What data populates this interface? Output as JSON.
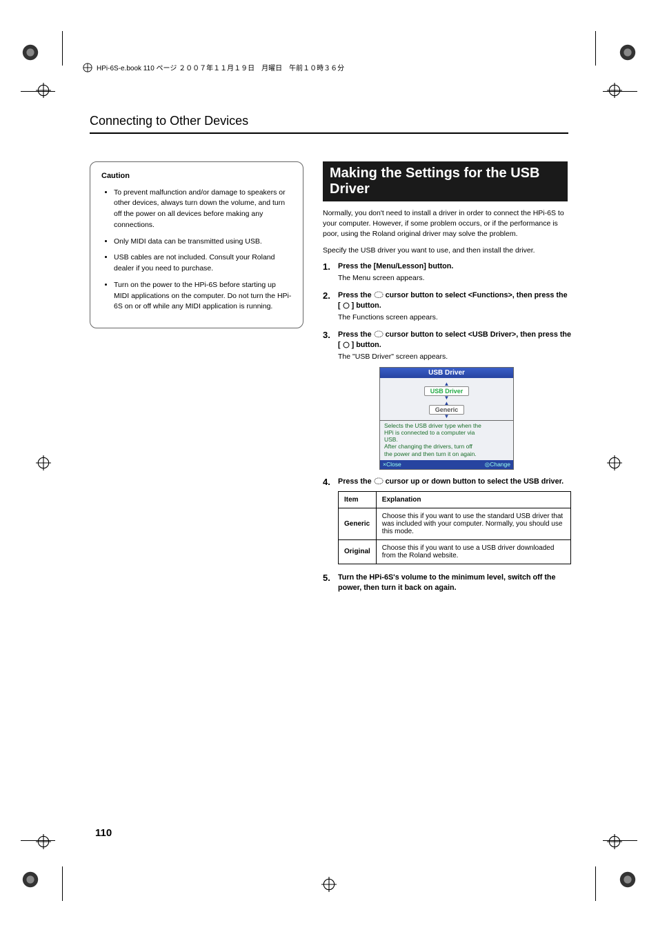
{
  "running_head": "HPi-6S-e.book  110 ページ  ２００７年１１月１９日　月曜日　午前１０時３６分",
  "section_title": "Connecting to Other Devices",
  "page_number": "110",
  "caution": {
    "title": "Caution",
    "items": [
      "To prevent malfunction and/or damage to speakers or other devices, always turn down the volume, and turn off the power on all devices before making any connections.",
      "Only MIDI data can be transmitted using USB.",
      "USB cables are not included. Consult your Roland dealer if you need to purchase.",
      "Turn on the power to the HPi-6S before starting up MIDI applications on the computer. Do not turn the HPi-6S on or off while any MIDI application is running."
    ]
  },
  "right": {
    "heading": "Making the Settings for the USB Driver",
    "intro1": "Normally, you don't need to install a driver in order to connect the HPi-6S to your computer. However, if some problem occurs, or if the performance is poor, using the Roland original driver may solve the problem.",
    "intro2": "Specify the USB driver you want to use, and then install the driver.",
    "steps": {
      "s1_title": "Press the [Menu/Lesson] button.",
      "s1_sub": "The Menu screen appears.",
      "s2_a": "Press the ",
      "s2_b": " cursor button to select <Functions>, then press the [ ",
      "s2_c": " ] button.",
      "s2_sub": "The Functions screen appears.",
      "s3_a": "Press the ",
      "s3_b": " cursor button to select <USB Driver>, then press the [ ",
      "s3_c": " ] button.",
      "s3_sub": "The \"USB Driver\" screen appears.",
      "s4_a": "Press the ",
      "s4_b": " cursor up or down button to select the USB driver.",
      "s5": "Turn the HPi-6S's volume to the minimum level, switch off the power, then turn it back on again."
    },
    "screenshot": {
      "titlebar": "USB Driver",
      "chip1": "USB Driver",
      "chip2": "Generic",
      "desc_l1": "Selects the USB driver type when the",
      "desc_l2": "HPi is connected to a computer via",
      "desc_l3": "USB.",
      "desc_l4": "After changing the drivers, turn off",
      "desc_l5": "the power and then turn it on again.",
      "foot_left": "×Close",
      "foot_right": "◎Change"
    },
    "table": {
      "h1": "Item",
      "h2": "Explanation",
      "r1c1": "Generic",
      "r1c2": "Choose this if you want to use the standard USB driver that was included with your computer. Normally, you should use this mode.",
      "r2c1": "Original",
      "r2c2": "Choose this if you want to use a USB driver downloaded from the Roland website."
    }
  }
}
